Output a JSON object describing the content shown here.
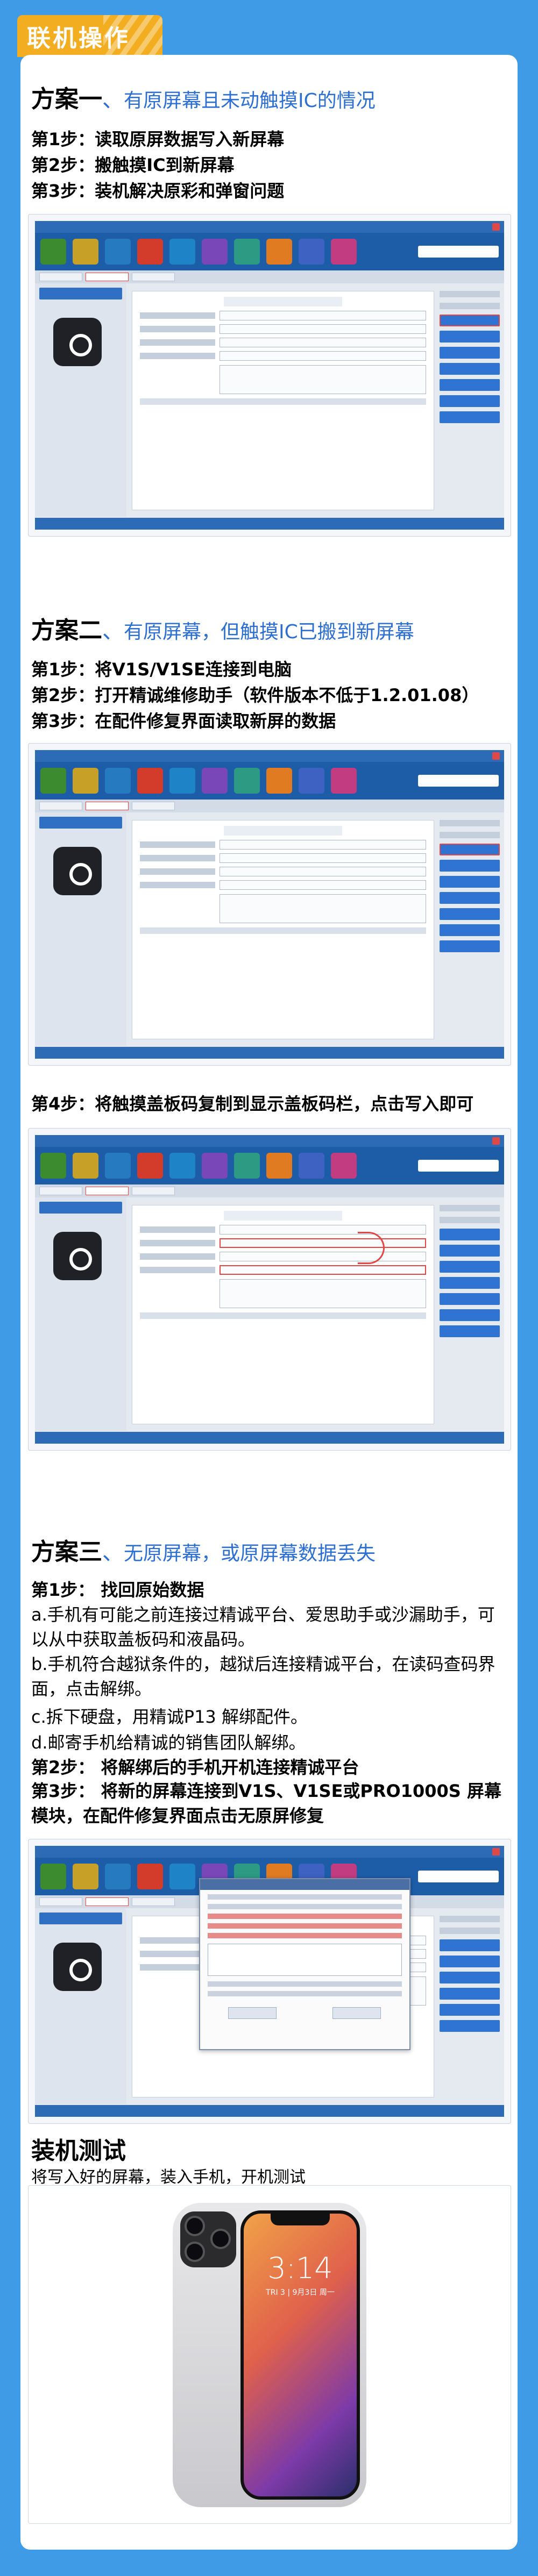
{
  "header": {
    "badge_title": "联机操作"
  },
  "plan1": {
    "title_main": "方案一",
    "title_dash": "、",
    "title_tail": "有原屏幕且未动触摸IC的情况",
    "steps": [
      "第1步：读取原屏数据写入新屏幕",
      "第2步：搬触摸IC到新屏幕",
      "第3步：装机解决原彩和弹窗问题"
    ]
  },
  "plan2": {
    "title_main": "方案二",
    "title_dash": "、",
    "title_tail": "有原屏幕，但触摸IC已搬到新屏幕",
    "steps": [
      "第1步：将V1S/V1SE连接到电脑",
      "第2步：打开精诚维修助手（软件版本不低于1.2.01.08）",
      "第3步：在配件修复界面读取新屏的数据"
    ],
    "step4": "第4步：将触摸盖板码复制到显示盖板码栏，点击写入即可"
  },
  "plan3": {
    "title_main": "方案三",
    "title_dash": "、",
    "title_tail": "无原屏幕，或原屏幕数据丢失",
    "step1": "第1步：  找回原始数据",
    "sub": [
      "a.手机有可能之前连接过精诚平台、爱思助手或沙漏助手，可以从中获取盖板码和液晶码。",
      "b.手机符合越狱条件的，越狱后连接精诚平台，在读码查码界面，点击解绑。",
      "c.拆下硬盘，用精诚P13 解绑配件。",
      "d.邮寄手机给精诚的销售团队解绑。"
    ],
    "step2": "第2步：  将解绑后的手机开机连接精诚平台",
    "step3": "第3步：  将新的屏幕连接到V1S、V1SE或PRO1000S 屏幕模块，在配件修复界面点击无原屏修复"
  },
  "install": {
    "title": "装机测试",
    "desc": "将写入好的屏幕，装入手机，开机测试",
    "phone_time": "3:14",
    "phone_date": "TRI 3 | 9月3日 周一"
  }
}
